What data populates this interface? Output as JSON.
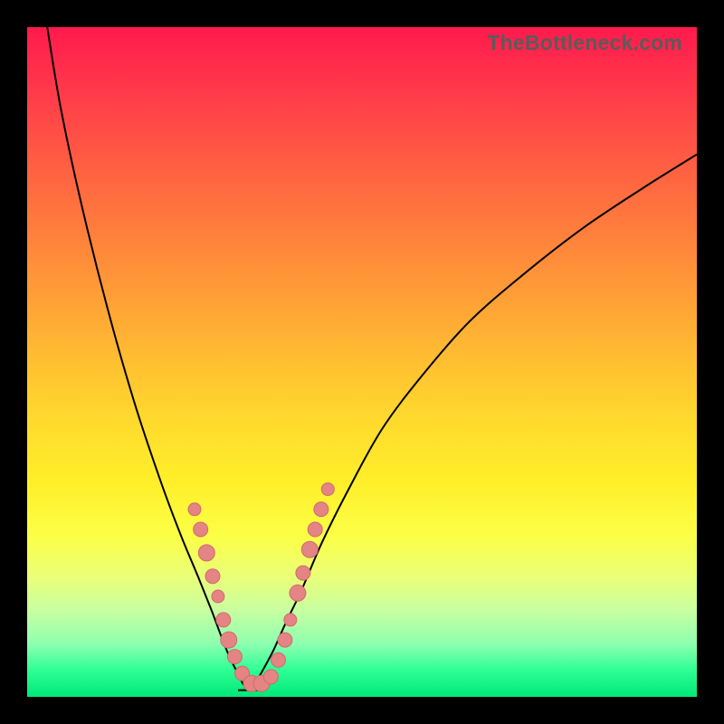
{
  "watermark": "TheBottleneck.com",
  "colors": {
    "curve": "#000000",
    "dot_fill": "#e48484",
    "dot_stroke": "#d06a6a",
    "gradient_top": "#ff1a4d",
    "gradient_bottom": "#00e878",
    "frame": "#000000"
  },
  "chart_data": {
    "type": "line",
    "title": "",
    "xlabel": "",
    "ylabel": "",
    "xrange": [
      0,
      100
    ],
    "yrange": [
      0,
      100
    ],
    "series": [
      {
        "name": "left-branch",
        "x": [
          3.0,
          5.0,
          8.0,
          12.0,
          16.0,
          20.0,
          23.0,
          25.5,
          27.5,
          29.0,
          30.2,
          31.2,
          32.2,
          33.0
        ],
        "y": [
          100,
          88,
          74,
          58,
          44,
          32,
          24,
          18,
          13,
          9,
          6,
          4,
          2,
          1
        ]
      },
      {
        "name": "right-branch",
        "x": [
          33.0,
          34.0,
          35.2,
          36.8,
          38.6,
          41.0,
          44.0,
          48.0,
          53.0,
          59.0,
          66.0,
          74.0,
          83.0,
          92.0,
          100.0
        ],
        "y": [
          1,
          2,
          4,
          7,
          11,
          16,
          23,
          31,
          40,
          48,
          56,
          63,
          70,
          76,
          81
        ]
      }
    ],
    "flat_segment": {
      "x_start": 31.5,
      "x_end": 35.0,
      "y": 1
    },
    "markers": {
      "name": "highlighted-points",
      "points": [
        {
          "x": 25.0,
          "y": 28.0,
          "r": 7
        },
        {
          "x": 25.9,
          "y": 25.0,
          "r": 8
        },
        {
          "x": 26.8,
          "y": 21.5,
          "r": 9
        },
        {
          "x": 27.7,
          "y": 18.0,
          "r": 8
        },
        {
          "x": 28.5,
          "y": 15.0,
          "r": 7
        },
        {
          "x": 29.3,
          "y": 11.5,
          "r": 8
        },
        {
          "x": 30.1,
          "y": 8.5,
          "r": 9
        },
        {
          "x": 31.0,
          "y": 6.0,
          "r": 8
        },
        {
          "x": 32.1,
          "y": 3.5,
          "r": 8
        },
        {
          "x": 33.5,
          "y": 2.0,
          "r": 9
        },
        {
          "x": 35.0,
          "y": 2.0,
          "r": 9
        },
        {
          "x": 36.4,
          "y": 3.0,
          "r": 8
        },
        {
          "x": 37.5,
          "y": 5.5,
          "r": 8
        },
        {
          "x": 38.5,
          "y": 8.5,
          "r": 8
        },
        {
          "x": 39.3,
          "y": 11.5,
          "r": 7
        },
        {
          "x": 40.4,
          "y": 15.5,
          "r": 9
        },
        {
          "x": 41.2,
          "y": 18.5,
          "r": 8
        },
        {
          "x": 42.2,
          "y": 22.0,
          "r": 9
        },
        {
          "x": 43.0,
          "y": 25.0,
          "r": 8
        },
        {
          "x": 43.9,
          "y": 28.0,
          "r": 8
        },
        {
          "x": 44.9,
          "y": 31.0,
          "r": 7
        }
      ]
    }
  }
}
